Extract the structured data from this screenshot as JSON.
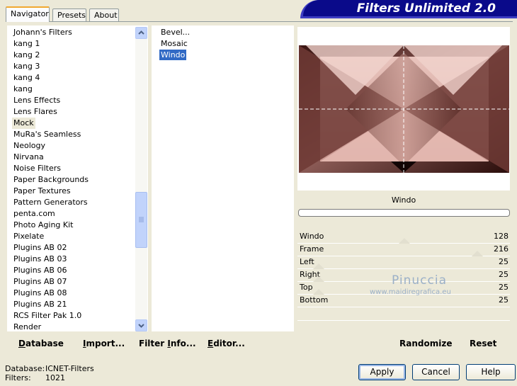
{
  "tabs": [
    "Navigator",
    "Presets",
    "About"
  ],
  "banner": "Filters Unlimited 2.0",
  "categories": [
    "Johann's Filters",
    "kang 1",
    "kang 2",
    "kang 3",
    "kang 4",
    "kang",
    "Lens Effects",
    "Lens Flares",
    "Mock",
    "MuRa's Seamless",
    "Neology",
    "Nirvana",
    "Noise Filters",
    "Paper Backgrounds",
    "Paper Textures",
    "Pattern Generators",
    "penta.com",
    "Photo Aging Kit",
    "Pixelate",
    "Plugins AB 02",
    "Plugins AB 03",
    "Plugins AB 06",
    "Plugins AB 07",
    "Plugins AB 08",
    "Plugins AB 21",
    "RCS Filter Pak 1.0",
    "Render"
  ],
  "selected_category": "Mock",
  "filters": [
    "Bevel...",
    "Mosaic",
    "Windo"
  ],
  "selected_filter": "Windo",
  "preview_title": "Windo",
  "sliders": [
    {
      "label": "Windo",
      "value": "128"
    },
    {
      "label": "Frame",
      "value": "216"
    },
    {
      "label": "Left",
      "value": "25"
    },
    {
      "label": "Right",
      "value": "25"
    },
    {
      "label": "Top",
      "value": "25"
    },
    {
      "label": "Bottom",
      "value": "25"
    }
  ],
  "watermark": {
    "line1": "Pinuccia",
    "line2": "www.maidiregrafica.eu"
  },
  "left_buttons": {
    "database": {
      "u": "D",
      "rest": "atabase"
    },
    "import": {
      "u": "I",
      "rest": "mport..."
    },
    "filter_info": {
      "pre": "Filter ",
      "u": "I",
      "rest": "nfo..."
    },
    "editor": {
      "u": "E",
      "rest": "ditor..."
    }
  },
  "right_buttons": {
    "randomize": "Randomize",
    "reset": "Reset"
  },
  "status": {
    "database_label": "Database:",
    "database_value": "ICNET-Filters",
    "filters_label": "Filters:",
    "filters_value": "1021"
  },
  "dialog_buttons": {
    "apply": "Apply",
    "cancel": "Cancel",
    "help": "Help"
  },
  "colors": {
    "accent": "#316ac5",
    "banner": "#0a0a8a",
    "dialog_bg": "#ece9d8"
  }
}
